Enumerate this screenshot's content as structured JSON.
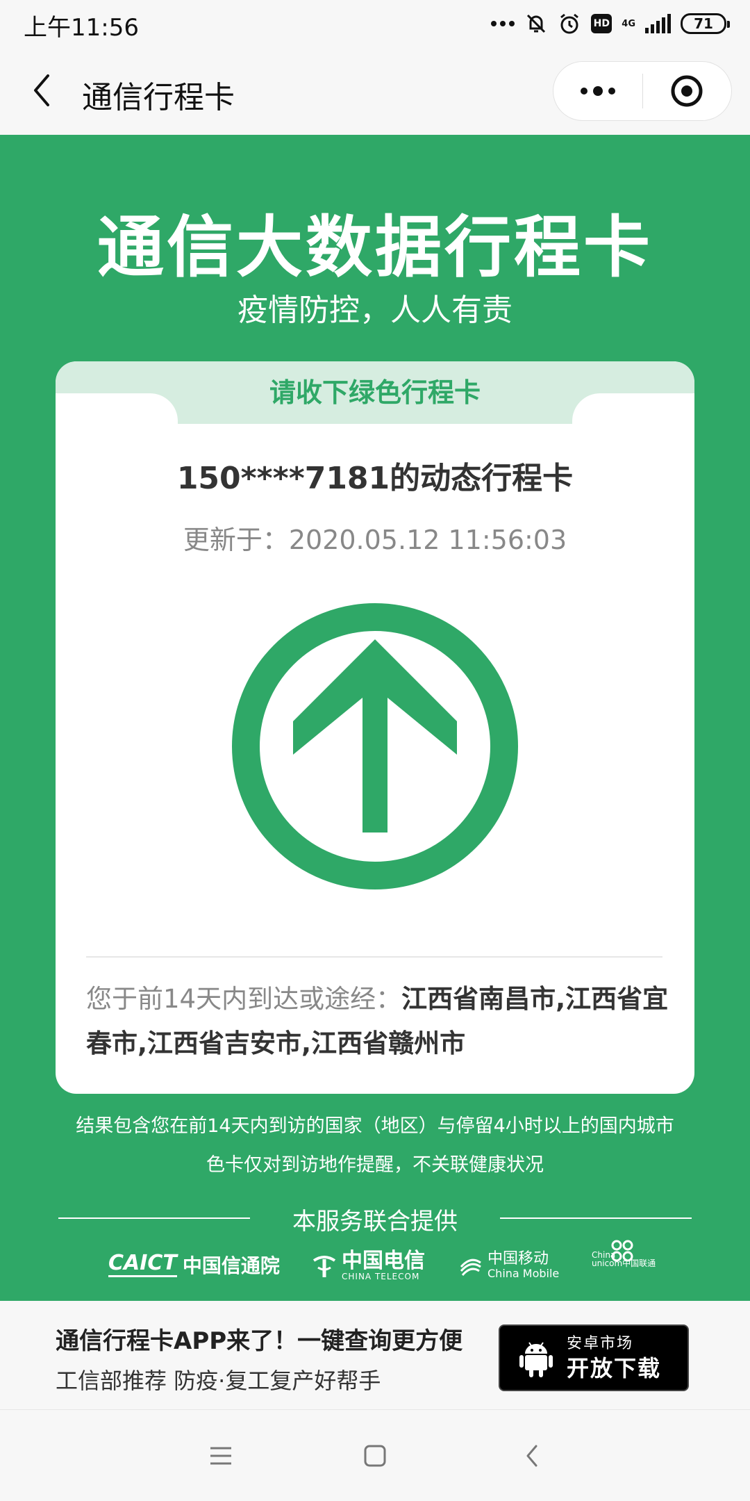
{
  "status_bar": {
    "time": "上午11:56",
    "network": "4G",
    "hd": "HD",
    "battery": "71"
  },
  "nav": {
    "title": "通信行程卡"
  },
  "hero": {
    "title": "通信大数据行程卡",
    "subtitle": "疫情防控，人人有责"
  },
  "card": {
    "tab_label": "请收下绿色行程卡",
    "heading": "150****7181的动态行程卡",
    "updated_prefix": "更新于：",
    "updated_time": "2020.05.12 11:56:03",
    "status_color": "#2fa867",
    "visited_prefix": "您于前14天内到达或途经：",
    "visited_places": "江西省南昌市,江西省宜春市,江西省吉安市,江西省赣州市"
  },
  "notes": {
    "line1": "结果包含您在前14天内到访的国家（地区）与停留4小时以上的国内城市",
    "line2": "色卡仅对到访地作提醒，不关联健康状况"
  },
  "providers": {
    "label": "本服务联合提供",
    "caict_mark": "CAICT",
    "caict_name": "中国信通院",
    "telecom_name": "中国电信",
    "telecom_en": "CHINA TELECOM",
    "mobile_name": "中国移动",
    "mobile_en": "China Mobile",
    "unicom_en1": "China",
    "unicom_en2": "unicom中国联通"
  },
  "promo": {
    "title": "通信行程卡APP来了！一键查询更方便",
    "subtitle": "工信部推荐 防疫·复工复产好帮手",
    "button_top": "安卓市场",
    "button_main": "开放下载"
  },
  "colors": {
    "brand_green": "#2fa867",
    "tab_green_light": "#d6ede0"
  }
}
